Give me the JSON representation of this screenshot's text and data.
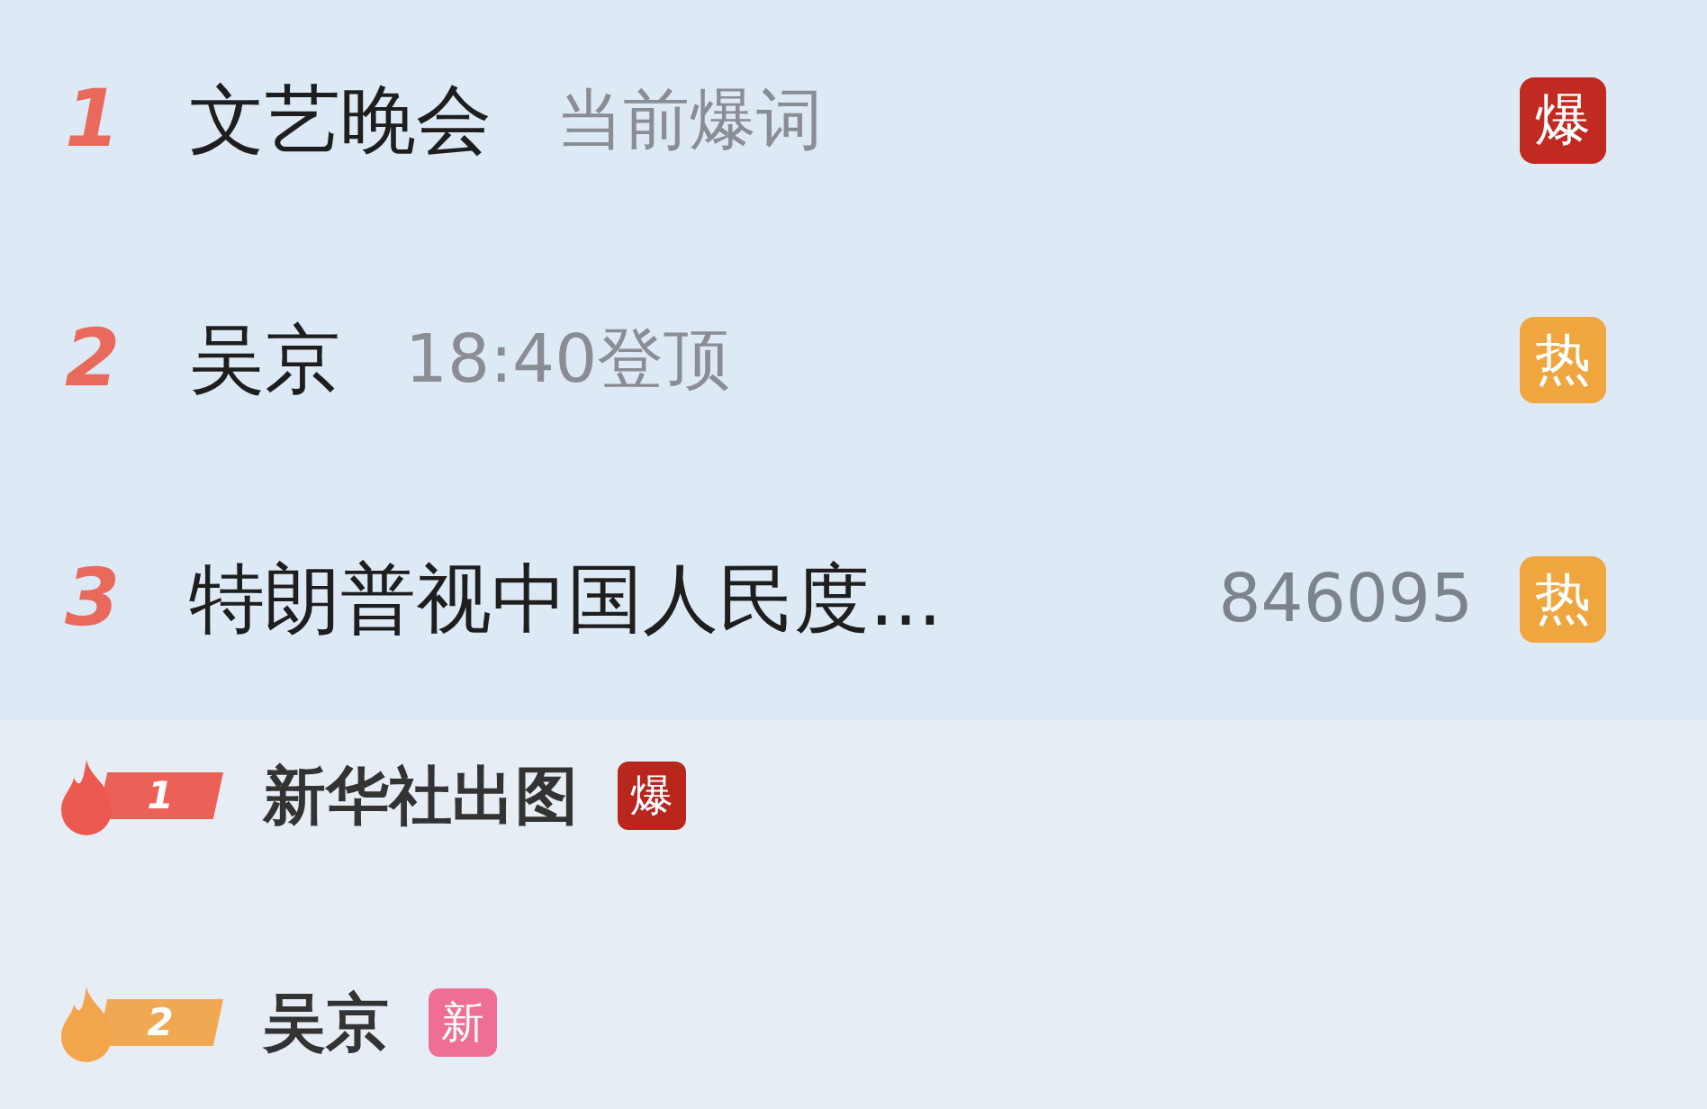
{
  "top_list": [
    {
      "rank": "1",
      "title": "文艺晚会",
      "note": "当前爆词",
      "badge": {
        "label": "爆",
        "color": "#c12a20"
      }
    },
    {
      "rank": "2",
      "title": "吴京",
      "note": "18:40登顶",
      "badge": {
        "label": "热",
        "color": "#f0a63e"
      }
    },
    {
      "rank": "3",
      "title": "特朗普视中国人民度...",
      "count": "846095",
      "badge": {
        "label": "热",
        "color": "#f0a63e"
      }
    }
  ],
  "sub_list": [
    {
      "rank": "1",
      "color": "#ec5a4f",
      "title": "新华社出图",
      "badge": {
        "label": "爆",
        "color": "#b8261e"
      }
    },
    {
      "rank": "2",
      "color": "#f2a54a",
      "title": "吴京",
      "badge": {
        "label": "新",
        "color": "#ee6f93"
      }
    }
  ]
}
